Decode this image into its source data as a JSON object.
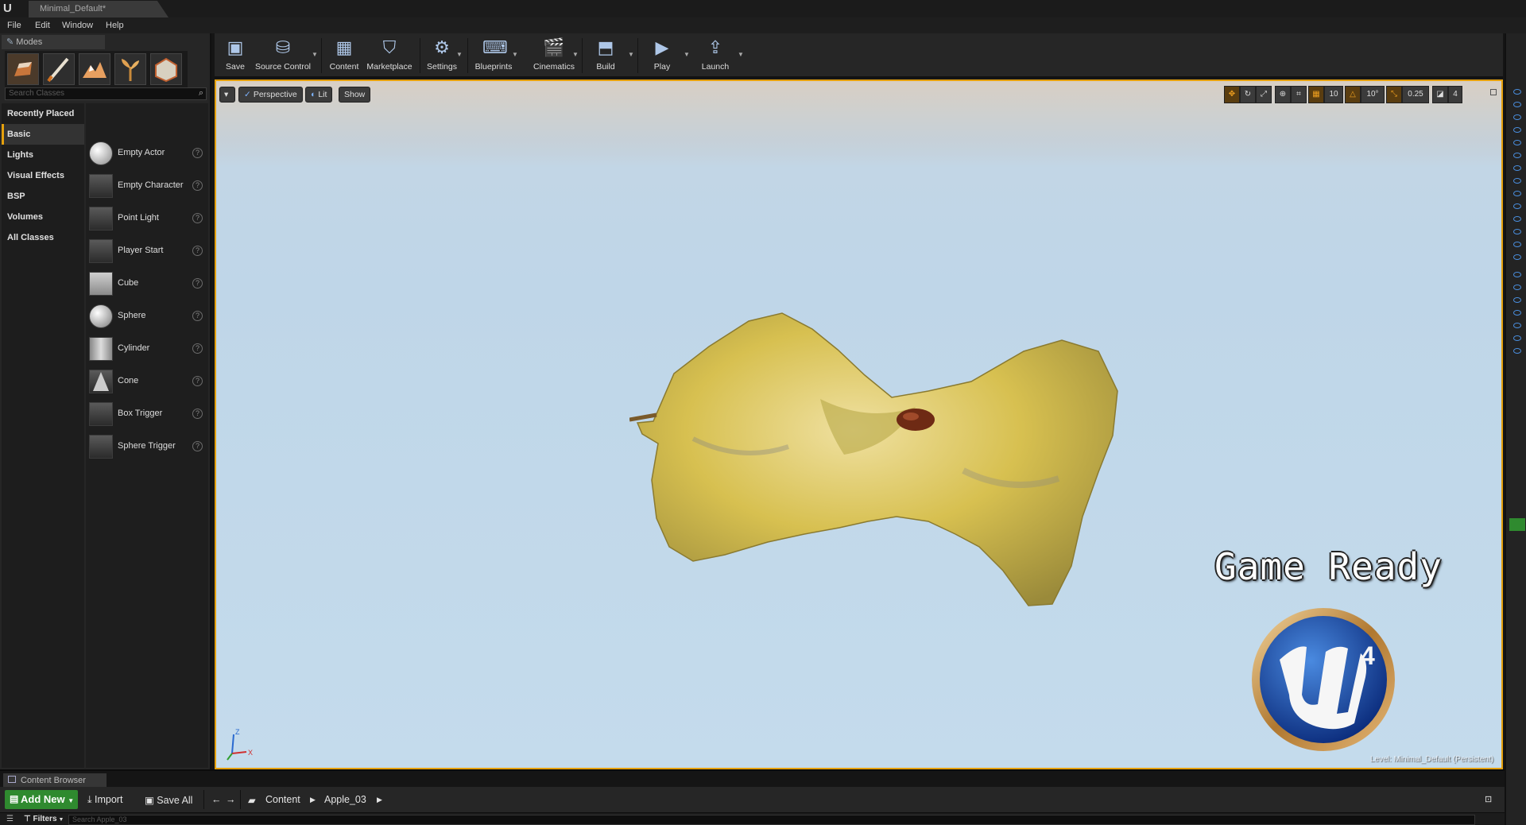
{
  "window": {
    "logo_text": "U",
    "doc_tab": "Minimal_Default*"
  },
  "menu": [
    "File",
    "Edit",
    "Window",
    "Help"
  ],
  "modes": {
    "tab_label": "Modes",
    "search_placeholder": "Search Classes",
    "categories": [
      "Recently Placed",
      "Basic",
      "Lights",
      "Visual Effects",
      "BSP",
      "Volumes",
      "All Classes"
    ],
    "active_category": "Basic",
    "items": [
      "Empty Actor",
      "Empty Character",
      "Point Light",
      "Player Start",
      "Cube",
      "Sphere",
      "Cylinder",
      "Cone",
      "Box Trigger",
      "Sphere Trigger"
    ],
    "help_glyph": "?"
  },
  "toolbar": {
    "buttons": [
      "Save",
      "Source Control",
      "Content",
      "Marketplace",
      "Settings",
      "Blueprints",
      "Cinematics",
      "Build",
      "Play",
      "Launch"
    ]
  },
  "viewport": {
    "dropdown_glyph": "▾",
    "perspective": "Perspective",
    "lit": "Lit",
    "show": "Show",
    "grid_snap": "10",
    "rotation_snap": "10°",
    "scale_snap": "0.25",
    "camera_speed": "4",
    "overlay_text": "Game Ready",
    "level_label": "Level:  Minimal_Default (Persistent)",
    "badge_number": "4",
    "axis_labels": [
      "Z",
      "X"
    ]
  },
  "content_browser": {
    "tab_label": "Content Browser",
    "add_new": "Add New",
    "import": "Import",
    "save_all": "Save All",
    "path": [
      "Content",
      "Apple_03"
    ],
    "filters": "Filters",
    "search_placeholder": "Search Apple_03"
  },
  "colors": {
    "accent": "#e5a00d",
    "add_new": "#2f8a2f",
    "viewport_sky": "#c4dbec",
    "apple": "#d9c24f"
  }
}
